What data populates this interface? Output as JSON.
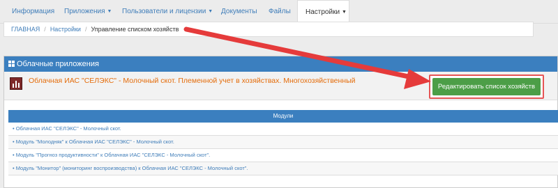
{
  "nav": {
    "items": [
      {
        "label": "Информация",
        "dropdown": false
      },
      {
        "label": "Приложения",
        "dropdown": true
      },
      {
        "label": "Пользователи и лицензии",
        "dropdown": true
      },
      {
        "label": "Документы",
        "dropdown": false
      },
      {
        "label": "Файлы",
        "dropdown": false
      },
      {
        "label": "Настройки",
        "dropdown": true,
        "active": true
      }
    ]
  },
  "breadcrumb": {
    "home": "ГЛАВНАЯ",
    "settings": "Настройки",
    "current": "Управление списком хозяйств",
    "separator": "/"
  },
  "panel": {
    "title": "Облачные приложения",
    "app_title": "Облачная ИАС \"СЕЛЭКС\" - Молочный скот. Племенной учет в хозяйствах. Многохозяйственный",
    "edit_button": "Редактировать список хозяйств"
  },
  "table": {
    "header": "Модули",
    "rows": [
      "• Облачная ИАС \"СЕЛЭКС\" - Молочный скот.",
      "• Модуль \"Молодняк\" к Облачная ИАС \"СЕЛЭКС\" - Молочный скот.",
      "• Модуль \"Прогноз продуктивности\" к Облачная ИАС \"СЕЛЭКС - Молочный скот\".",
      "• Модуль \"Монитор\" (мониторинг воспроизводства) к Облачная ИАС \"СЕЛЭКС - Молочный скот\"."
    ]
  },
  "colors": {
    "accent": "#3b7fbf",
    "app_title": "#e46c0a",
    "button": "#4c9e47",
    "highlight": "#e65555"
  }
}
